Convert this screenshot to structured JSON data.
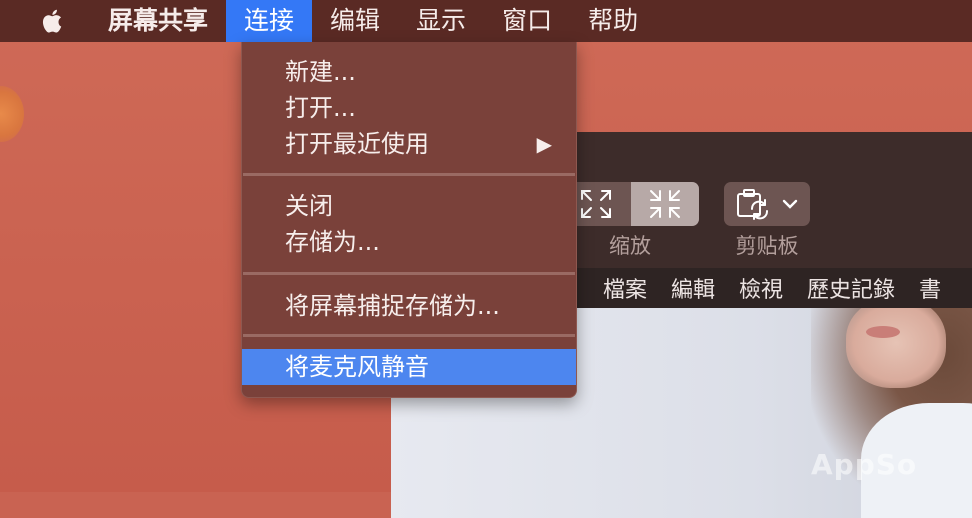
{
  "menubar": {
    "app_name": "屏幕共享",
    "items": [
      "连接",
      "编辑",
      "显示",
      "窗口",
      "帮助"
    ],
    "active_item": "连接"
  },
  "connect_menu": {
    "items": [
      {
        "label": "新建..."
      },
      {
        "label": "打开..."
      },
      {
        "label": "打开最近使用",
        "submenu_arrow": "▶"
      },
      {
        "label": "关闭"
      },
      {
        "label": "存储为..."
      },
      {
        "label": "将屏幕捕捉存储为..."
      },
      {
        "label": "将麦克风静音",
        "highlighted": true
      }
    ]
  },
  "window": {
    "toolbar": {
      "scale_label": "缩放",
      "clipboard_label": "剪贴板"
    },
    "remote_menubar": [
      "檔案",
      "編輯",
      "檢視",
      "歷史記錄",
      "書"
    ],
    "watermark": "AppSo"
  },
  "colors": {
    "menubar_bg": "#5a2a24",
    "accent": "#3478f6",
    "desktop": "#c96352",
    "menu_bg": "#7a413a"
  }
}
